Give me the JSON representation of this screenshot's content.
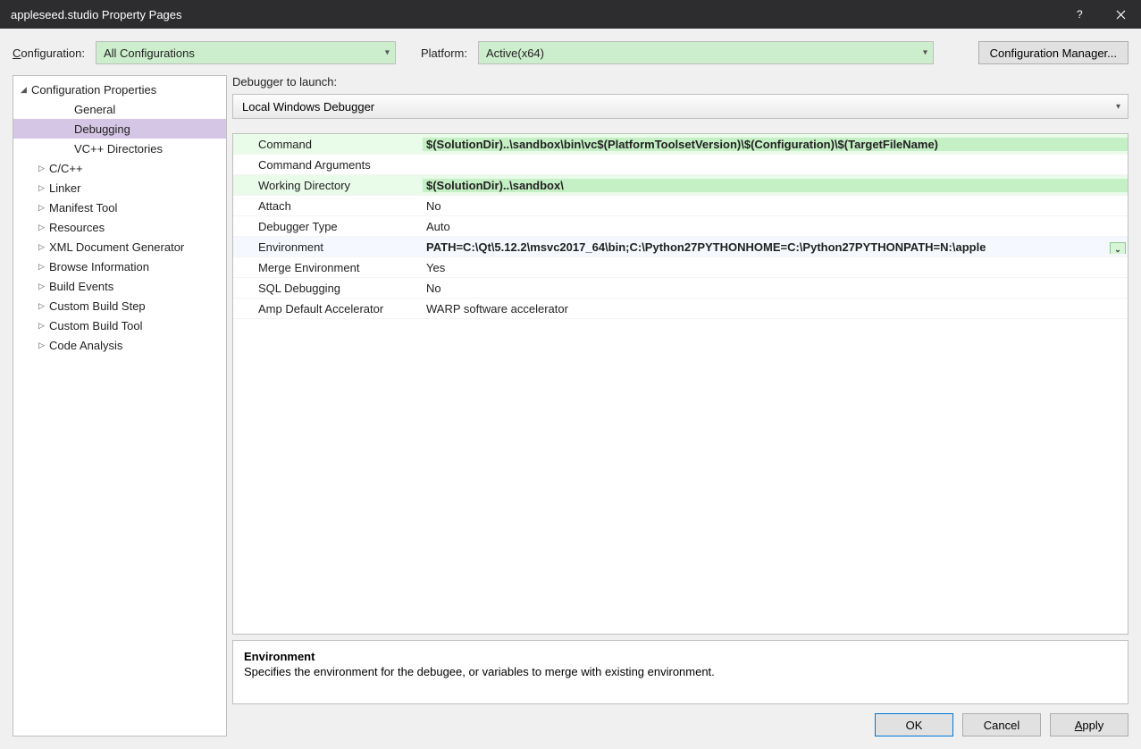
{
  "window": {
    "title": "appleseed.studio Property Pages"
  },
  "toolbar": {
    "config_label_pre": "C",
    "config_label_post": "onfiguration:",
    "config_value": "All Configurations",
    "platform_label_pre": "P",
    "platform_label_post": "latform:",
    "platform_value": "Active(x64)",
    "manager_btn": "Configuration Manager..."
  },
  "tree": {
    "root": "Configuration Properties",
    "items": [
      {
        "label": "General",
        "level": 2,
        "expandable": false,
        "selected": false
      },
      {
        "label": "Debugging",
        "level": 2,
        "expandable": false,
        "selected": true
      },
      {
        "label": "VC++ Directories",
        "level": 2,
        "expandable": false,
        "selected": false
      },
      {
        "label": "C/C++",
        "level": 1,
        "expandable": true,
        "selected": false
      },
      {
        "label": "Linker",
        "level": 1,
        "expandable": true,
        "selected": false
      },
      {
        "label": "Manifest Tool",
        "level": 1,
        "expandable": true,
        "selected": false
      },
      {
        "label": "Resources",
        "level": 1,
        "expandable": true,
        "selected": false
      },
      {
        "label": "XML Document Generator",
        "level": 1,
        "expandable": true,
        "selected": false
      },
      {
        "label": "Browse Information",
        "level": 1,
        "expandable": true,
        "selected": false
      },
      {
        "label": "Build Events",
        "level": 1,
        "expandable": true,
        "selected": false
      },
      {
        "label": "Custom Build Step",
        "level": 1,
        "expandable": true,
        "selected": false
      },
      {
        "label": "Custom Build Tool",
        "level": 1,
        "expandable": true,
        "selected": false
      },
      {
        "label": "Code Analysis",
        "level": 1,
        "expandable": true,
        "selected": false
      }
    ]
  },
  "launcher": {
    "label": "Debugger to launch:",
    "value": "Local Windows Debugger"
  },
  "grid": {
    "rows": [
      {
        "k": "Command",
        "v": "$(SolutionDir)..\\sandbox\\bin\\vc$(PlatformToolsetVersion)\\$(Configuration)\\$(TargetFileName)",
        "hl": true
      },
      {
        "k": "Command Arguments",
        "v": ""
      },
      {
        "k": "Working Directory",
        "v": "$(SolutionDir)..\\sandbox\\",
        "hl": true
      },
      {
        "k": "Attach",
        "v": "No"
      },
      {
        "k": "Debugger Type",
        "v": "Auto"
      },
      {
        "k": "Environment",
        "v": "PATH=C:\\Qt\\5.12.2\\msvc2017_64\\bin;C:\\Python27PYTHONHOME=C:\\Python27PYTHONPATH=N:\\apple",
        "sel": true
      },
      {
        "k": "Merge Environment",
        "v": "Yes"
      },
      {
        "k": "SQL Debugging",
        "v": "No"
      },
      {
        "k": "Amp Default Accelerator",
        "v": "WARP software accelerator"
      }
    ]
  },
  "desc": {
    "title": "Environment",
    "text": "Specifies the environment for the debugee, or variables to merge with existing environment."
  },
  "footer": {
    "ok": "OK",
    "cancel": "Cancel",
    "apply_pre": "A",
    "apply_post": "pply"
  }
}
